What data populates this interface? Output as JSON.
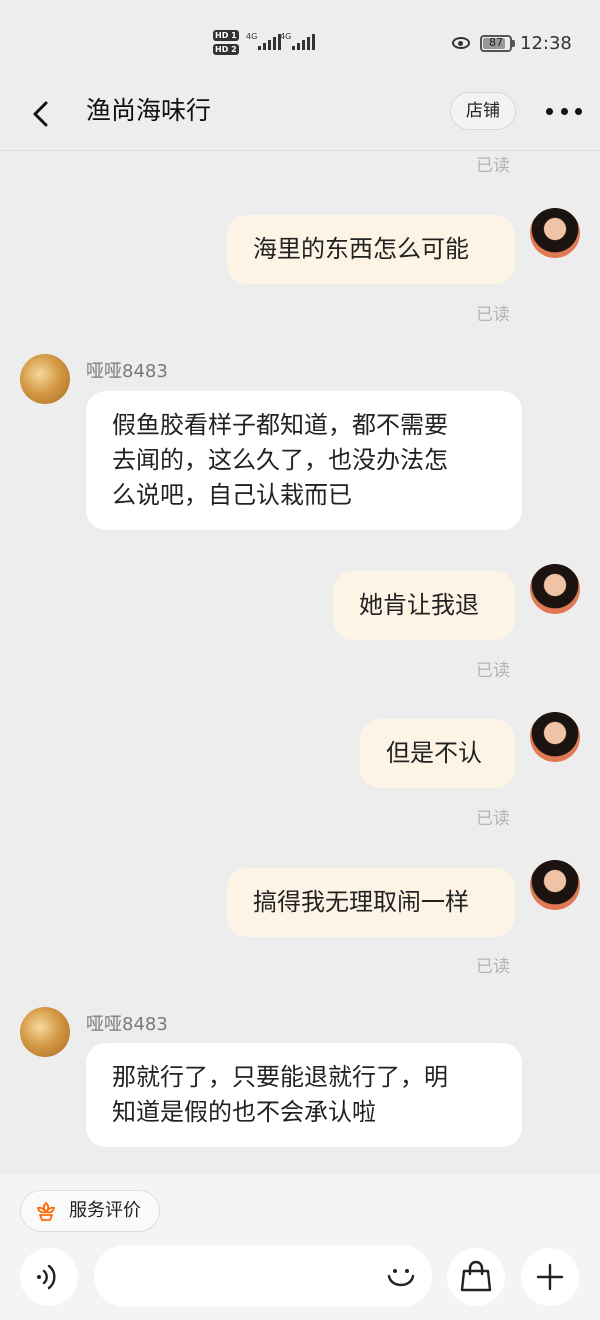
{
  "status_bar": {
    "sim1": "HD 1",
    "sim2": "HD 2",
    "network1": "4G",
    "network2": "4G",
    "battery": "87",
    "battery_level": 0.87,
    "time": "12:38"
  },
  "header": {
    "title": "渔尚海味行",
    "shop_button": "店铺"
  },
  "chat": {
    "top_read": "已读",
    "messages": [
      {
        "from": "me",
        "text": "海里的东西怎么可能",
        "read": "已读"
      },
      {
        "from": "shop",
        "sender": "哑哑8483",
        "lines": [
          "假鱼胶看样子都知道，都不需要",
          "去闻的，这么久了，也没办法怎",
          "么说吧，自己认栽而已"
        ]
      },
      {
        "from": "me",
        "text": "她肯让我退",
        "read": "已读"
      },
      {
        "from": "me",
        "text": "但是不认",
        "read": "已读"
      },
      {
        "from": "me",
        "text": "搞得我无理取闹一样",
        "read": "已读"
      },
      {
        "from": "shop",
        "sender": "哑哑8483",
        "lines": [
          "那就行了，只要能退就行了，明",
          "知道是假的也不会承认啦"
        ]
      }
    ]
  },
  "bottom_bar": {
    "service_label": "服务评价",
    "input_placeholder": ""
  },
  "colors": {
    "background": "#ededed",
    "my_bubble": "#fdf4e6",
    "shop_bubble": "#ffffff",
    "accent": "#ff6a00"
  }
}
